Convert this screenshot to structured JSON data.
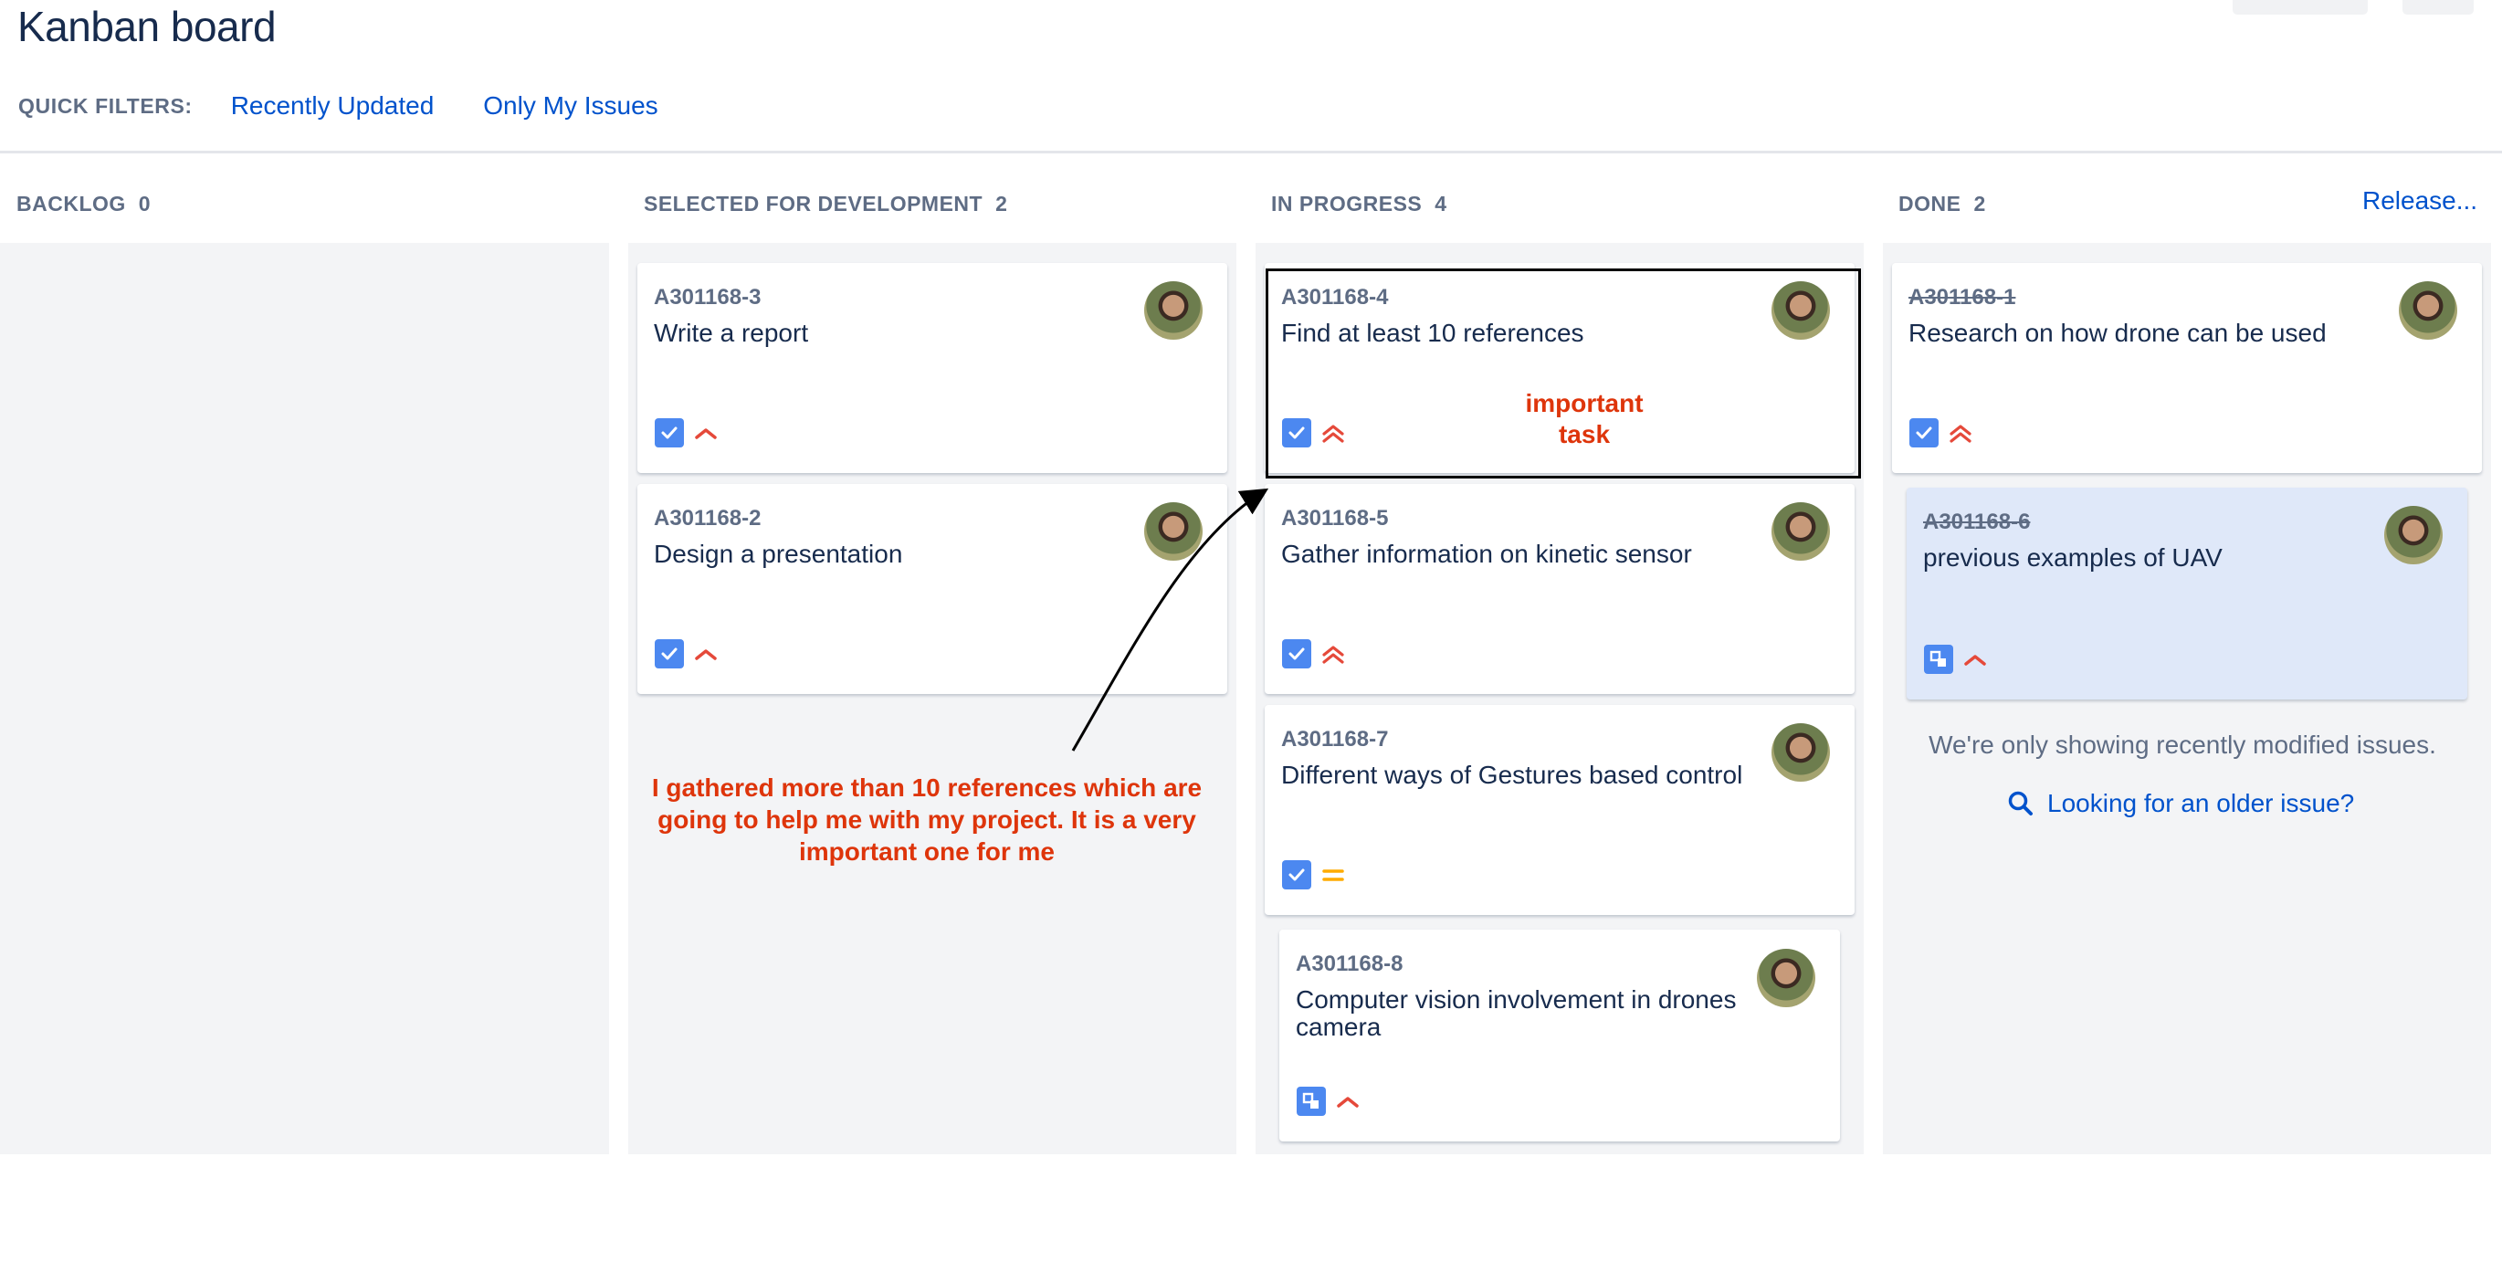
{
  "header": {
    "title": "Kanban board",
    "quick_filters_label": "QUICK FILTERS:",
    "filters": [
      "Recently Updated",
      "Only My Issues"
    ]
  },
  "columns": [
    {
      "name": "BACKLOG",
      "count": "0"
    },
    {
      "name": "SELECTED FOR DEVELOPMENT",
      "count": "2"
    },
    {
      "name": "IN PROGRESS",
      "count": "4"
    },
    {
      "name": "DONE",
      "count": "2"
    }
  ],
  "release_label": "Release...",
  "cards": {
    "a3": {
      "key": "A301168-3",
      "summary": "Write a report",
      "type": "task",
      "priority": "high"
    },
    "a2": {
      "key": "A301168-2",
      "summary": "Design a presentation",
      "type": "task",
      "priority": "high"
    },
    "a4": {
      "key": "A301168-4",
      "summary": "Find at least 10 references",
      "type": "task",
      "priority": "highest"
    },
    "a5": {
      "key": "A301168-5",
      "summary": "Gather information on kinetic sensor",
      "type": "task",
      "priority": "highest"
    },
    "a7": {
      "key": "A301168-7",
      "summary": "Different ways of Gestures based control",
      "type": "task",
      "priority": "medium"
    },
    "a8": {
      "key": "A301168-8",
      "summary": "Computer vision involvement in drones camera",
      "type": "subtask",
      "priority": "high"
    },
    "a1": {
      "key": "A301168-1",
      "summary": "Research on how drone can be used",
      "type": "task",
      "priority": "highest"
    },
    "a6": {
      "key": "A301168-6",
      "summary": "previous examples of UAV",
      "type": "subtask",
      "priority": "high"
    }
  },
  "annotations": {
    "important": "important task",
    "note": "I gathered more than 10 references which are going to help me with my project. It is a very important one for me"
  },
  "done_info": "We're only showing recently modified issues.",
  "older_link": "Looking for an older issue?",
  "colors": {
    "link": "#0052cc",
    "annotation": "#de350b",
    "priority_high": "#e5493a",
    "priority_medium": "#ffab00",
    "type_icon": "#4c88f0"
  }
}
